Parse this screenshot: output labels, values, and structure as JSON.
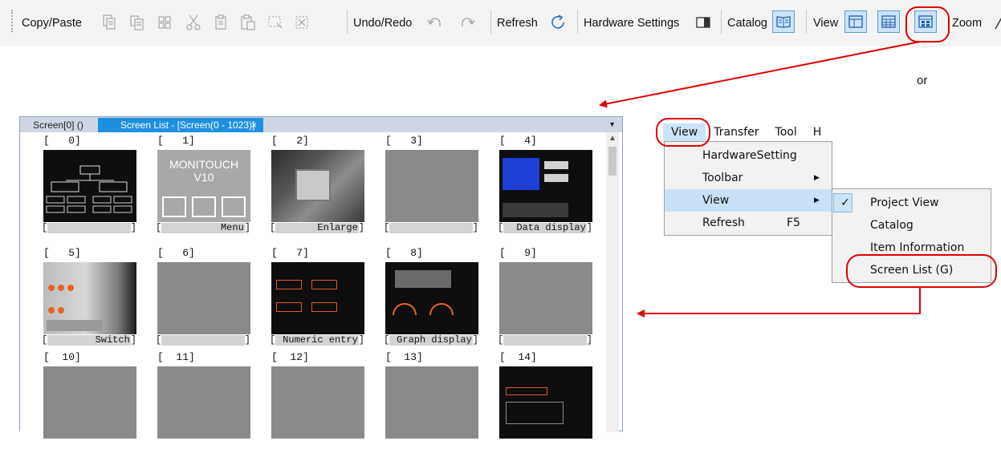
{
  "toolbar": {
    "copy_paste": "Copy/Paste",
    "undo_redo": "Undo/Redo",
    "refresh": "Refresh",
    "hardware_settings": "Hardware Settings",
    "catalog": "Catalog",
    "view": "View",
    "zoom": "Zoom"
  },
  "annotation": {
    "or": "or",
    "color": "#e00000"
  },
  "window": {
    "tabs": [
      "Screen[0] ()",
      "Screen List - [Screen(0 - 1023)]"
    ],
    "close": "×",
    "dropdown": "▼",
    "scroll_up": "▲",
    "screens": [
      {
        "num": "[   0]",
        "name": ""
      },
      {
        "num": "[   1]",
        "name": "Menu"
      },
      {
        "num": "[   2]",
        "name": "Enlarge"
      },
      {
        "num": "[   3]",
        "name": ""
      },
      {
        "num": "[   4]",
        "name": "Data display"
      },
      {
        "num": "[   5]",
        "name": "Switch"
      },
      {
        "num": "[   6]",
        "name": ""
      },
      {
        "num": "[   7]",
        "name": "Numeric entry"
      },
      {
        "num": "[   8]",
        "name": "Graph display"
      },
      {
        "num": "[   9]",
        "name": ""
      },
      {
        "num": "[  10]",
        "name": ""
      },
      {
        "num": "[  11]",
        "name": ""
      },
      {
        "num": "[  12]",
        "name": ""
      },
      {
        "num": "[  13]",
        "name": ""
      },
      {
        "num": "[  14]",
        "name": ""
      }
    ],
    "monitouch": {
      "line1": "MONITOUCH",
      "line2": "V10"
    }
  },
  "menubar": {
    "items": [
      "View",
      "Transfer",
      "Tool",
      "H"
    ]
  },
  "view_menu": {
    "items": [
      {
        "label": "HardwareSetting",
        "shortcut": ""
      },
      {
        "label": "Toolbar",
        "shortcut": ""
      },
      {
        "label": "View",
        "shortcut": ""
      },
      {
        "label": "Refresh",
        "shortcut": "F5"
      }
    ]
  },
  "view_submenu": {
    "items": [
      "Project View",
      "Catalog",
      "Item Information",
      "Screen List (G)"
    ],
    "checked": "✓"
  }
}
